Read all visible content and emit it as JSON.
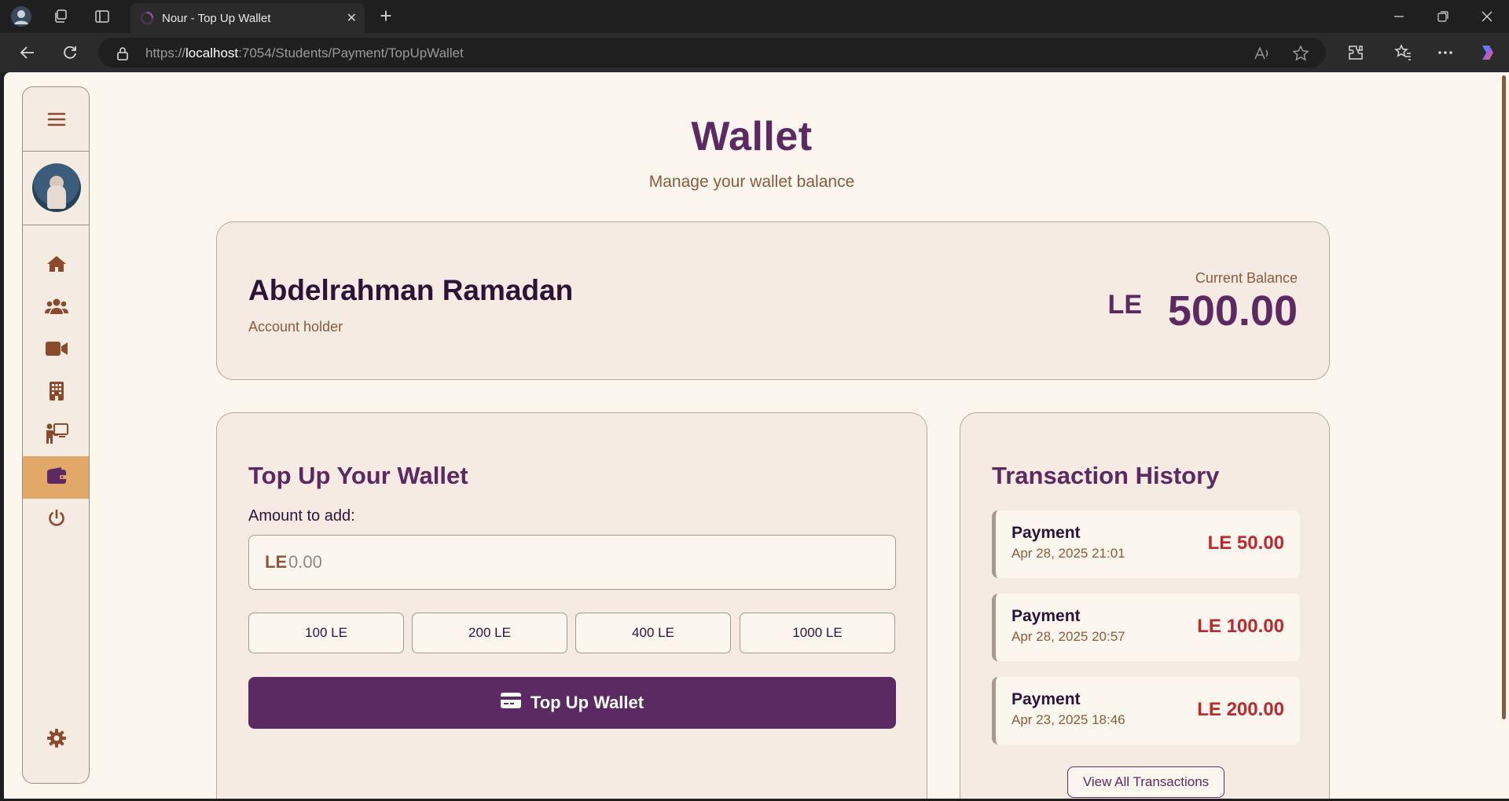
{
  "browser": {
    "tab_title": "Nour - Top Up Wallet",
    "url_scheme": "https://",
    "url_host": "localhost",
    "url_path": ":7054/Students/Payment/TopUpWallet"
  },
  "sidebar": {
    "items": [
      {
        "icon": "home-icon"
      },
      {
        "icon": "users-icon"
      },
      {
        "icon": "video-icon"
      },
      {
        "icon": "building-icon"
      },
      {
        "icon": "teacher-icon"
      },
      {
        "icon": "wallet-icon",
        "active": true
      },
      {
        "icon": "power-icon"
      }
    ],
    "settings_icon": "gear-icon"
  },
  "header": {
    "title": "Wallet",
    "subtitle": "Manage your wallet balance"
  },
  "account": {
    "name": "Abdelrahman Ramadan",
    "role": "Account holder",
    "balance_label": "Current Balance",
    "currency": "LE",
    "balance": "500.00"
  },
  "topup": {
    "title": "Top Up Your Wallet",
    "amount_label": "Amount to add:",
    "currency": "LE",
    "placeholder": "0.00",
    "quick_amounts": [
      "100 LE",
      "200 LE",
      "400 LE",
      "1000 LE"
    ],
    "submit_label": "Top Up Wallet"
  },
  "transactions": {
    "title": "Transaction History",
    "items": [
      {
        "type": "Payment",
        "date": "Apr 28, 2025 21:01",
        "amount": "LE 50.00"
      },
      {
        "type": "Payment",
        "date": "Apr 28, 2025 20:57",
        "amount": "LE 100.00"
      },
      {
        "type": "Payment",
        "date": "Apr 23, 2025 18:46",
        "amount": "LE 200.00"
      }
    ],
    "view_all_label": "View All Transactions"
  },
  "colors": {
    "brand": "#5b2a63",
    "accent": "#e2a868",
    "brown": "#8b5a3c",
    "negative": "#c0272d",
    "background": "#fbf6ee"
  }
}
